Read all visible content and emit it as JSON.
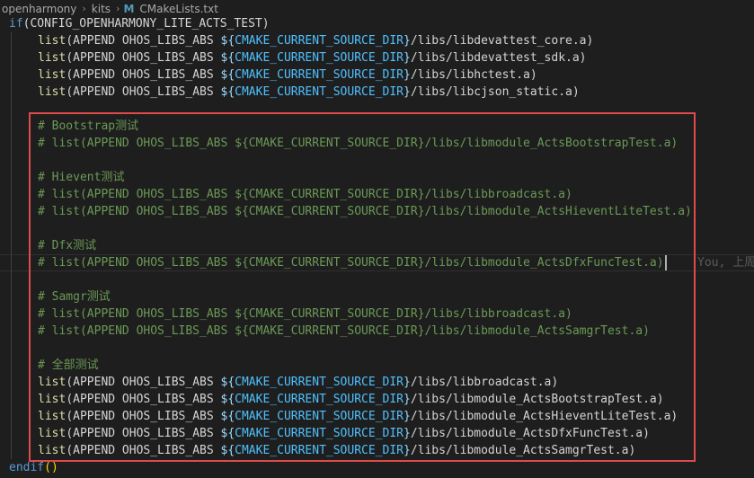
{
  "breadcrumb": {
    "items": [
      "openharmony",
      "kits"
    ],
    "file_icon": "M",
    "file_name": "CMakeLists.txt"
  },
  "editor": {
    "lines": [
      {
        "type": "if",
        "kw": "if",
        "cond": "(CONFIG_OPENHARMONY_LITE_ACTS_TEST)"
      },
      {
        "type": "code",
        "indent": 1,
        "fn": "list",
        "a": "(APPEND OHOS_LIBS_ABS ",
        "dl": "${",
        "v": "CMAKE_CURRENT_SOURCE_DIR",
        "dr": "}",
        "tail": "/libs/libdevattest_core.a)"
      },
      {
        "type": "code",
        "indent": 1,
        "fn": "list",
        "a": "(APPEND OHOS_LIBS_ABS ",
        "dl": "${",
        "v": "CMAKE_CURRENT_SOURCE_DIR",
        "dr": "}",
        "tail": "/libs/libdevattest_sdk.a)"
      },
      {
        "type": "code",
        "indent": 1,
        "fn": "list",
        "a": "(APPEND OHOS_LIBS_ABS ",
        "dl": "${",
        "v": "CMAKE_CURRENT_SOURCE_DIR",
        "dr": "}",
        "tail": "/libs/libhctest.a)"
      },
      {
        "type": "code",
        "indent": 1,
        "fn": "list",
        "a": "(APPEND OHOS_LIBS_ABS ",
        "dl": "${",
        "v": "CMAKE_CURRENT_SOURCE_DIR",
        "dr": "}",
        "tail": "/libs/libcjson_static.a)"
      },
      {
        "type": "blank"
      },
      {
        "type": "comment",
        "indent": 1,
        "text": "# Bootstrap测试"
      },
      {
        "type": "comment",
        "indent": 1,
        "text": "# list(APPEND OHOS_LIBS_ABS ${CMAKE_CURRENT_SOURCE_DIR}/libs/libmodule_ActsBootstrapTest.a)"
      },
      {
        "type": "blank"
      },
      {
        "type": "comment",
        "indent": 1,
        "text": "# Hievent测试"
      },
      {
        "type": "comment",
        "indent": 1,
        "text": "# list(APPEND OHOS_LIBS_ABS ${CMAKE_CURRENT_SOURCE_DIR}/libs/libbroadcast.a)"
      },
      {
        "type": "comment",
        "indent": 1,
        "text": "# list(APPEND OHOS_LIBS_ABS ${CMAKE_CURRENT_SOURCE_DIR}/libs/libmodule_ActsHieventLiteTest.a)"
      },
      {
        "type": "blank"
      },
      {
        "type": "comment",
        "indent": 1,
        "text": "# Dfx测试"
      },
      {
        "type": "comment",
        "indent": 1,
        "text": "# list(APPEND OHOS_LIBS_ABS ${CMAKE_CURRENT_SOURCE_DIR}/libs/libmodule_ActsDfxFuncTest.a)",
        "current": true,
        "blame": "You, 上周"
      },
      {
        "type": "blank"
      },
      {
        "type": "comment",
        "indent": 1,
        "text": "# Samgr测试"
      },
      {
        "type": "comment",
        "indent": 1,
        "text": "# list(APPEND OHOS_LIBS_ABS ${CMAKE_CURRENT_SOURCE_DIR}/libs/libbroadcast.a)"
      },
      {
        "type": "comment",
        "indent": 1,
        "text": "# list(APPEND OHOS_LIBS_ABS ${CMAKE_CURRENT_SOURCE_DIR}/libs/libmodule_ActsSamgrTest.a)"
      },
      {
        "type": "blank"
      },
      {
        "type": "comment",
        "indent": 1,
        "text": "# 全部测试"
      },
      {
        "type": "code",
        "indent": 1,
        "fn": "list",
        "a": "(APPEND OHOS_LIBS_ABS ",
        "dl": "${",
        "v": "CMAKE_CURRENT_SOURCE_DIR",
        "dr": "}",
        "tail": "/libs/libbroadcast.a)"
      },
      {
        "type": "code",
        "indent": 1,
        "fn": "list",
        "a": "(APPEND OHOS_LIBS_ABS ",
        "dl": "${",
        "v": "CMAKE_CURRENT_SOURCE_DIR",
        "dr": "}",
        "tail": "/libs/libmodule_ActsBootstrapTest.a)"
      },
      {
        "type": "code",
        "indent": 1,
        "fn": "list",
        "a": "(APPEND OHOS_LIBS_ABS ",
        "dl": "${",
        "v": "CMAKE_CURRENT_SOURCE_DIR",
        "dr": "}",
        "tail": "/libs/libmodule_ActsHieventLiteTest.a)"
      },
      {
        "type": "code",
        "indent": 1,
        "fn": "list",
        "a": "(APPEND OHOS_LIBS_ABS ",
        "dl": "${",
        "v": "CMAKE_CURRENT_SOURCE_DIR",
        "dr": "}",
        "tail": "/libs/libmodule_ActsDfxFuncTest.a)"
      },
      {
        "type": "code",
        "indent": 1,
        "fn": "list",
        "a": "(APPEND OHOS_LIBS_ABS ",
        "dl": "${",
        "v": "CMAKE_CURRENT_SOURCE_DIR",
        "dr": "}",
        "tail": "/libs/libmodule_ActsSamgrTest.a)"
      },
      {
        "type": "endif",
        "kw": "endif",
        "paren": "()"
      }
    ]
  }
}
